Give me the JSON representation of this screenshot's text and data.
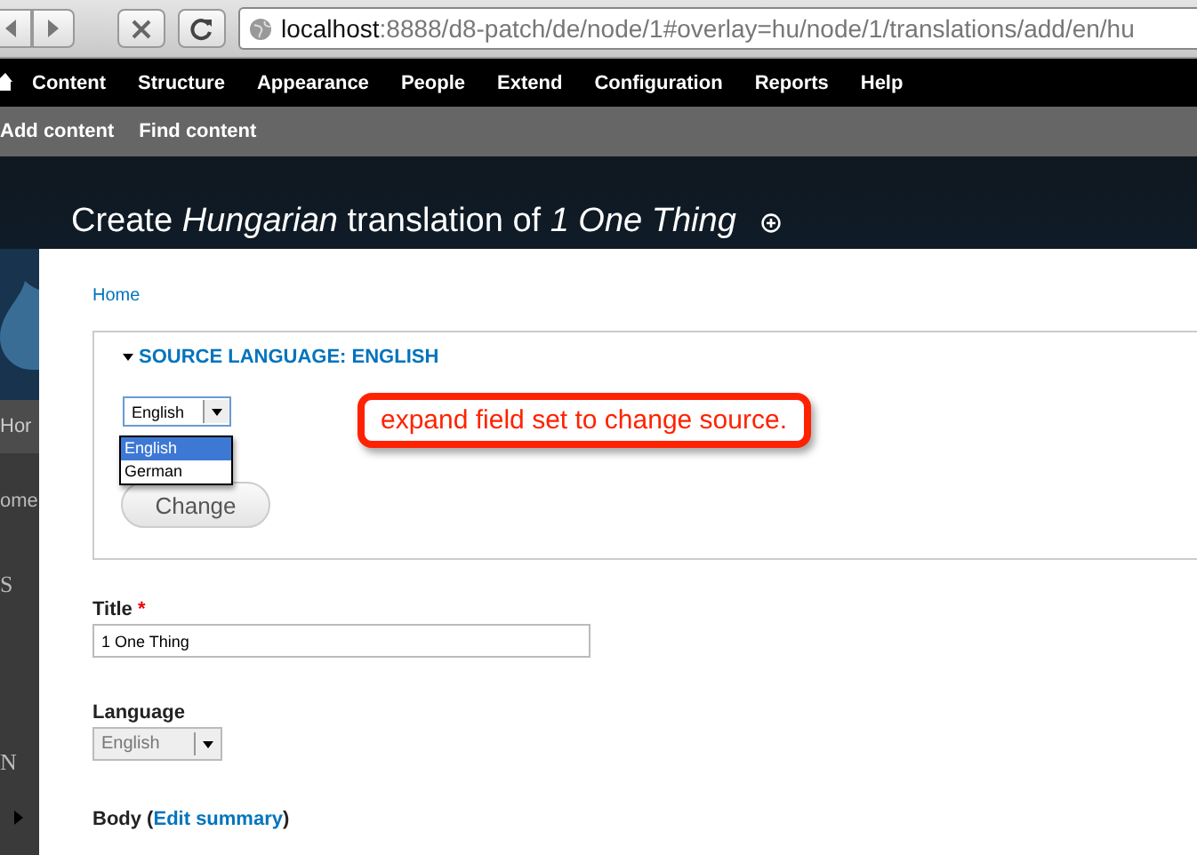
{
  "browser": {
    "url_host": "localhost",
    "url_rest": ":8888/d8-patch/de/node/1#overlay=hu/node/1/translations/add/en/hu"
  },
  "toolbar": {
    "items": [
      "Content",
      "Structure",
      "Appearance",
      "People",
      "Extend",
      "Configuration",
      "Reports",
      "Help"
    ]
  },
  "shortcuts": [
    "Add content",
    "Find content"
  ],
  "background_page": {
    "fragments": [
      "Hor",
      "ome",
      "S",
      "N"
    ]
  },
  "overlay": {
    "title": "Create *Hungarian* translation of *1 One Thing*"
  },
  "breadcrumb": "Home",
  "fieldset": {
    "legend": "SOURCE LANGUAGE: ENGLISH",
    "expanded": true,
    "select": {
      "value": "English",
      "open": true,
      "options": [
        {
          "label": "English",
          "selected": true
        },
        {
          "label": "German",
          "selected": false
        }
      ]
    },
    "button": "Change"
  },
  "callout": "expand field set to change source.",
  "title_field": {
    "label": "Title",
    "required_mark": "*",
    "value": "1 One Thing"
  },
  "language_field": {
    "label": "Language",
    "value": "English",
    "disabled": true
  },
  "body_field": {
    "label_before": "Body (",
    "link": "Edit summary",
    "label_after": ")"
  }
}
